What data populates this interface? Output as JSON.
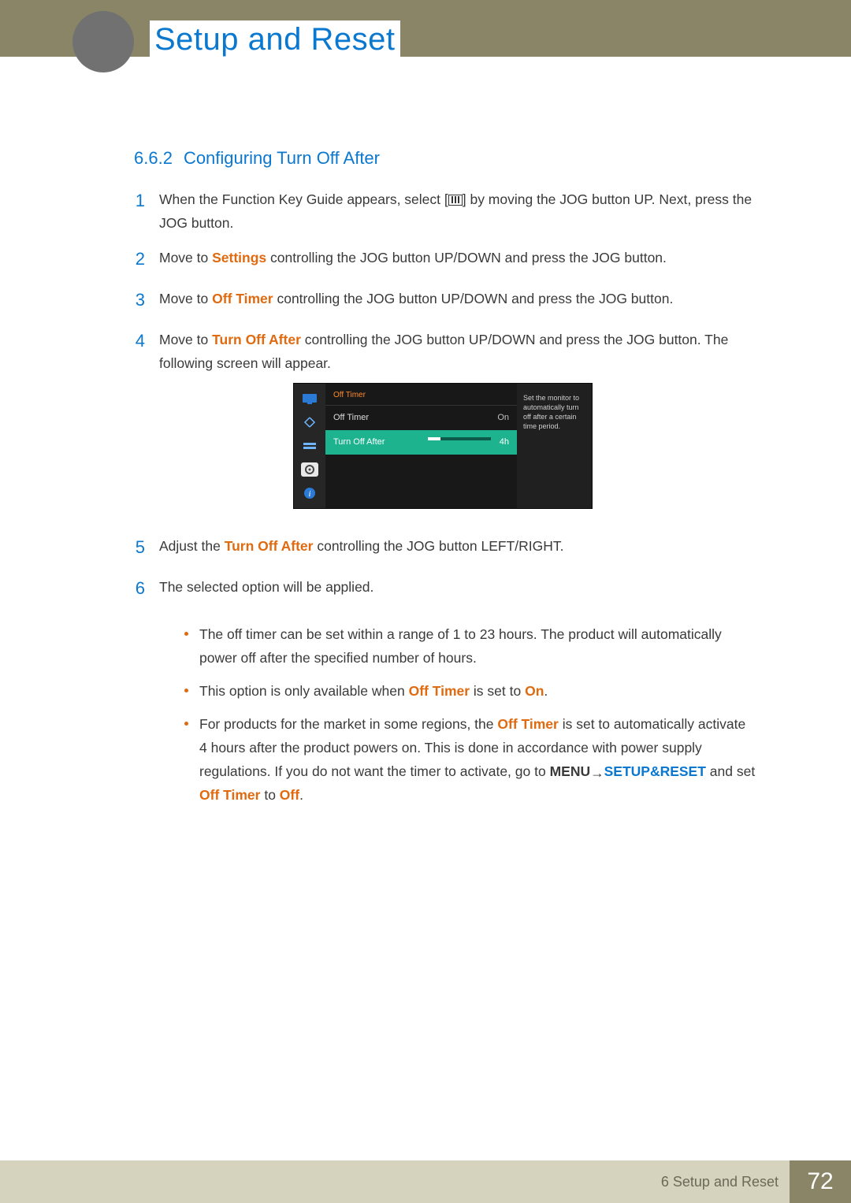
{
  "header": {
    "title": "Setup and Reset"
  },
  "section": {
    "number": "6.6.2",
    "title": "Configuring Turn Off After"
  },
  "steps": {
    "s1a": "When the Function Key Guide appears, select [",
    "s1b": "] by moving the JOG button UP. Next, press the JOG button.",
    "s2a": "Move to ",
    "s2_settings": "Settings",
    "s2b": " controlling the JOG button UP/DOWN and press the JOG button.",
    "s3a": "Move to ",
    "s3_offtimer": "Off Timer",
    "s3b": " controlling the JOG button UP/DOWN and press the JOG button.",
    "s4a": "Move to ",
    "s4_turnoff": "Turn Off After",
    "s4b": " controlling the JOG button UP/DOWN and press the JOG button. The following screen will appear.",
    "s5a": "Adjust the ",
    "s5_turnoff": "Turn Off After",
    "s5b": " controlling the JOG button LEFT/RIGHT.",
    "s6": "The selected option will be applied."
  },
  "step_numbers": {
    "n1": "1",
    "n2": "2",
    "n3": "3",
    "n4": "4",
    "n5": "5",
    "n6": "6"
  },
  "osd": {
    "crumb": "Off Timer",
    "row1_label": "Off Timer",
    "row1_value": "On",
    "row2_label": "Turn Off After",
    "row2_value": "4h",
    "desc": "Set the monitor to automatically turn off after a certain time period."
  },
  "notes": {
    "n1": "The off timer can be set within a range of 1 to 23 hours. The product will automatically power off after the specified number of hours.",
    "n2a": "This option is only available when ",
    "n2_offtimer": "Off Timer",
    "n2b": " is set to ",
    "n2_on": "On",
    "n2c": ".",
    "n3a": "For products for the market in some regions, the ",
    "n3_offtimer": "Off Timer",
    "n3b": " is set to automatically activate 4 hours after the product powers on. This is done in accordance with power supply regulations. If you do not want the timer to activate, go to ",
    "n3_menu": "MENU",
    "n3_arrow": " → ",
    "n3_setup": "SETUP&RESET",
    "n3c": " and set ",
    "n3_offtimer2": "Off Timer",
    "n3d": " to ",
    "n3_off": "Off",
    "n3e": "."
  },
  "footer": {
    "chapter": "6 Setup and Reset",
    "page": "72"
  }
}
